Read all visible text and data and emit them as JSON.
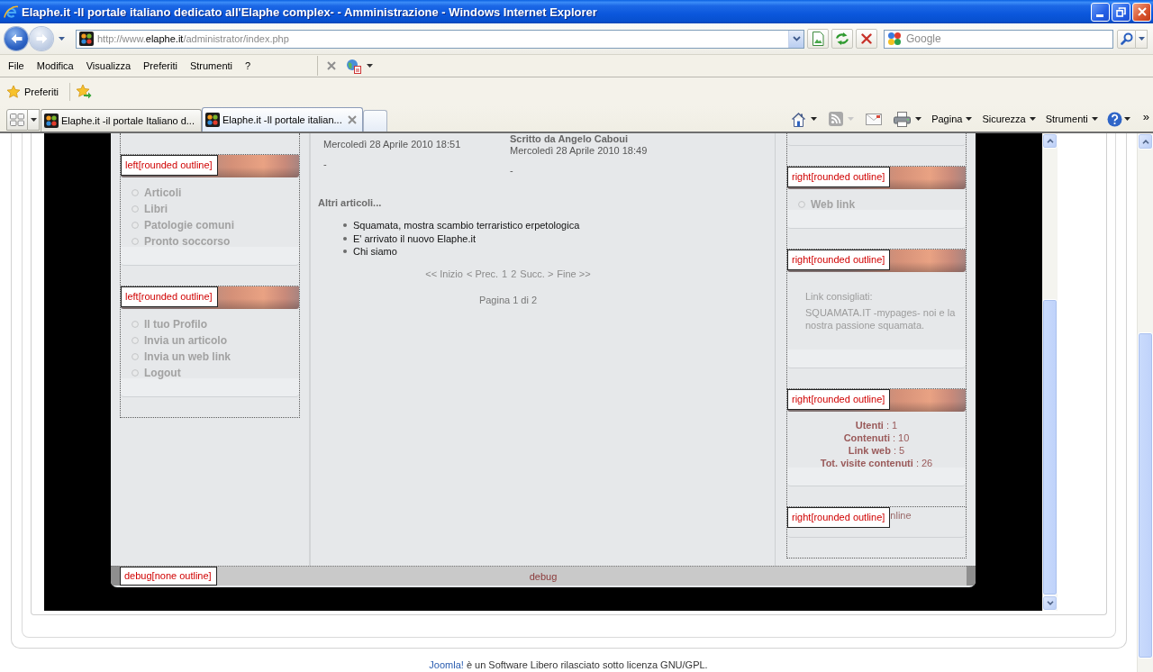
{
  "window": {
    "title": "Elaphe.it -Il portale italiano dedicato all'Elaphe complex- - Amministrazione - Windows Internet Explorer"
  },
  "address_bar": {
    "url": {
      "prefix": "http://www.",
      "domain": "elaphe.it",
      "path": "/administrator/index.php"
    }
  },
  "search": {
    "placeholder": "Google"
  },
  "menu_bar": {
    "items": [
      "File",
      "Modifica",
      "Visualizza",
      "Preferiti",
      "Strumenti",
      "?"
    ]
  },
  "favorites_bar": {
    "button": "Preferiti"
  },
  "tabs": [
    {
      "label": "Elaphe.it -il portale Italiano d...",
      "selected": false
    },
    {
      "label": "Elaphe.it -Il portale italian...",
      "selected": true
    }
  ],
  "command_bar": {
    "menus": [
      "Pagina",
      "Sicurezza",
      "Strumenti"
    ],
    "overflow": "»"
  },
  "page": {
    "left_modules": [
      {
        "kind": "menu",
        "label": "left[rounded outline]",
        "items": [
          "Articoli",
          "Libri",
          "Patologie comuni",
          "Pronto soccorso"
        ]
      },
      {
        "kind": "menu",
        "label": "left[rounded outline]",
        "items": [
          "Il tuo Profilo",
          "Invia un articolo",
          "Invia un web link",
          "Logout"
        ]
      }
    ],
    "entries": [
      {
        "date": "Mercoledì 28 Aprile 2010 18:51",
        "note": "-"
      },
      {
        "author": "Scritto da Angelo Caboui",
        "date": "Mercoledì 28 Aprile 2010 18:49",
        "note": "-"
      }
    ],
    "more_articles": {
      "title": "Altri articoli...",
      "items": [
        "Squamata, mostra scambio terraristico erpetologica",
        "E' arrivato il nuovo Elaphe.it",
        "Chi siamo"
      ]
    },
    "pagination": {
      "links": [
        "<< Inizio",
        "< Prec.",
        "1",
        "2",
        "Succ. >",
        "Fine >>"
      ],
      "counter": "Pagina 1 di 2"
    },
    "right_modules": [
      {
        "kind": "menu",
        "label": "right[rounded outline]",
        "items": [
          "Web link"
        ]
      },
      {
        "kind": "text",
        "label": "right[rounded outline]",
        "paragraphs": [
          "Link consigliati:",
          "SQUAMATA.IT -mypages- noi e la nostra passione squamata."
        ]
      },
      {
        "kind": "stats",
        "label": "right[rounded outline]",
        "lines": [
          "**Utenti** : 1",
          "**Contenuti** : 10",
          "**Link web** : 5",
          "**Tot. visite contenuti** : 26"
        ]
      },
      {
        "kind": "plain",
        "label": "right[rounded outline]",
        "text": "nline"
      }
    ],
    "debug": {
      "label": "debug[none outline]",
      "text": "debug"
    }
  },
  "footer": {
    "link": "Joomla!",
    "text": "è un Software Libero rilasciato sotto licenza GNU/GPL."
  }
}
